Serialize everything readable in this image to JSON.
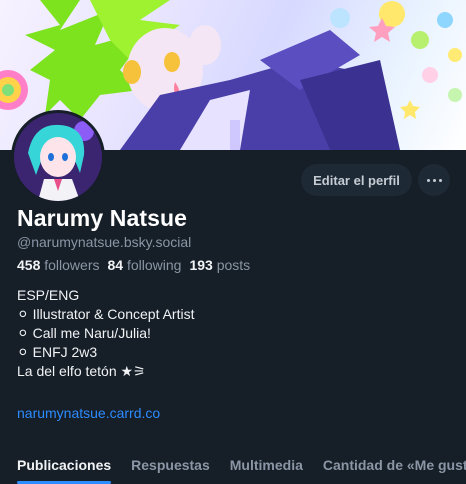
{
  "profile": {
    "display_name": "Narumy Natsue",
    "handle": "@narumynatsue.bsky.social",
    "followers_count": "458",
    "followers_label": "followers",
    "following_count": "84",
    "following_label": "following",
    "posts_count": "193",
    "posts_label": "posts"
  },
  "actions": {
    "edit_label": "Editar el perfil",
    "more_icon": "ellipsis-icon"
  },
  "bio": {
    "lines": [
      "ESP/ENG",
      "⚪ Illustrator & Concept Artist",
      "⚪ Call me Naru/Julia!",
      "⚪ ENFJ 2w3",
      "La del elfo tetón ★⚞"
    ],
    "link": "narumynatsue.carrd.co"
  },
  "tabs": [
    {
      "label": "Publicaciones",
      "active": true
    },
    {
      "label": "Respuestas",
      "active": false
    },
    {
      "label": "Multimedia",
      "active": false
    },
    {
      "label": "Cantidad de «Me gusta»",
      "active": false
    }
  ],
  "colors": {
    "background": "#161e27",
    "accent": "#2d8cff",
    "muted": "#8a96a5",
    "button_bg": "#1e2936"
  }
}
